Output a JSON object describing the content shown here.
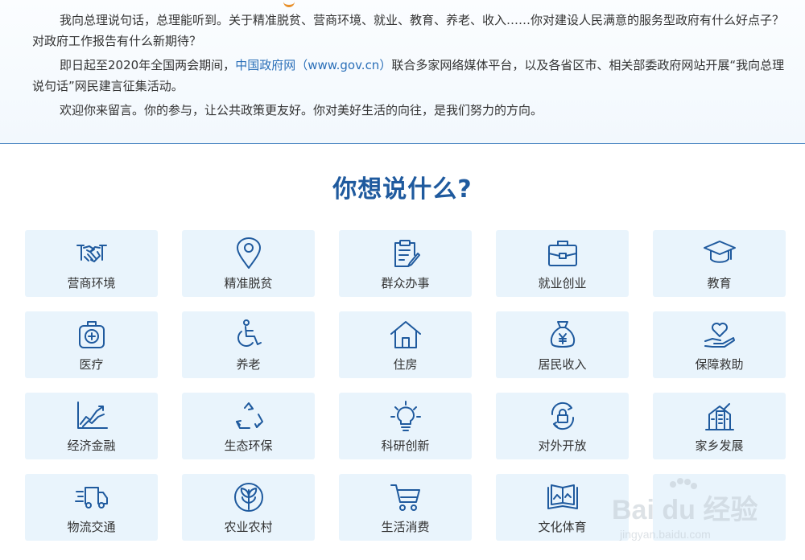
{
  "intro": {
    "paragraphs": [
      "我向总理说句话，总理能听到。关于精准脱贫、营商环境、就业、教育、养老、收入……你对建设人民满意的服务型政府有什么好点子？对政府工作报告有什么新期待？",
      {
        "before": "即日起至2020年全国两会期间，",
        "link": "中国政府网（www.gov.cn）",
        "after": "联合多家网络媒体平台，以及各省区市、相关部委政府网站开展“我向总理说句话”网民建言征集活动。"
      },
      "欢迎你来留言。你的参与，让公共政策更友好。你对美好生活的向往，是我们努力的方向。"
    ]
  },
  "section_title": "你想说什么?",
  "categories": [
    {
      "label": "营商环境",
      "icon": "handshake-icon"
    },
    {
      "label": "精准脱贫",
      "icon": "location-pin-icon"
    },
    {
      "label": "群众办事",
      "icon": "clipboard-pen-icon"
    },
    {
      "label": "就业创业",
      "icon": "briefcase-icon"
    },
    {
      "label": "教育",
      "icon": "graduation-cap-icon"
    },
    {
      "label": "医疗",
      "icon": "medical-kit-icon"
    },
    {
      "label": "养老",
      "icon": "wheelchair-icon"
    },
    {
      "label": "住房",
      "icon": "house-icon"
    },
    {
      "label": "居民收入",
      "icon": "money-bag-icon"
    },
    {
      "label": "保障救助",
      "icon": "heart-hand-icon"
    },
    {
      "label": "经济金融",
      "icon": "trend-chart-icon"
    },
    {
      "label": "生态环保",
      "icon": "recycle-icon"
    },
    {
      "label": "科研创新",
      "icon": "lightbulb-icon"
    },
    {
      "label": "对外开放",
      "icon": "globe-lock-icon"
    },
    {
      "label": "家乡发展",
      "icon": "buildings-icon"
    },
    {
      "label": "物流交通",
      "icon": "delivery-truck-icon"
    },
    {
      "label": "农业农村",
      "icon": "leaf-circle-icon"
    },
    {
      "label": "生活消费",
      "icon": "shopping-cart-icon"
    },
    {
      "label": "文化体育",
      "icon": "open-book-icon"
    },
    {
      "label": "",
      "icon": ""
    }
  ],
  "watermark": {
    "text": "Bai du 经验",
    "sub": "jingyan.baidu.com"
  },
  "colors": {
    "accent": "#1f5a9e",
    "link": "#2a6fb8",
    "tile_bg": "#e9f4fc",
    "divider": "#3f7fbf"
  }
}
